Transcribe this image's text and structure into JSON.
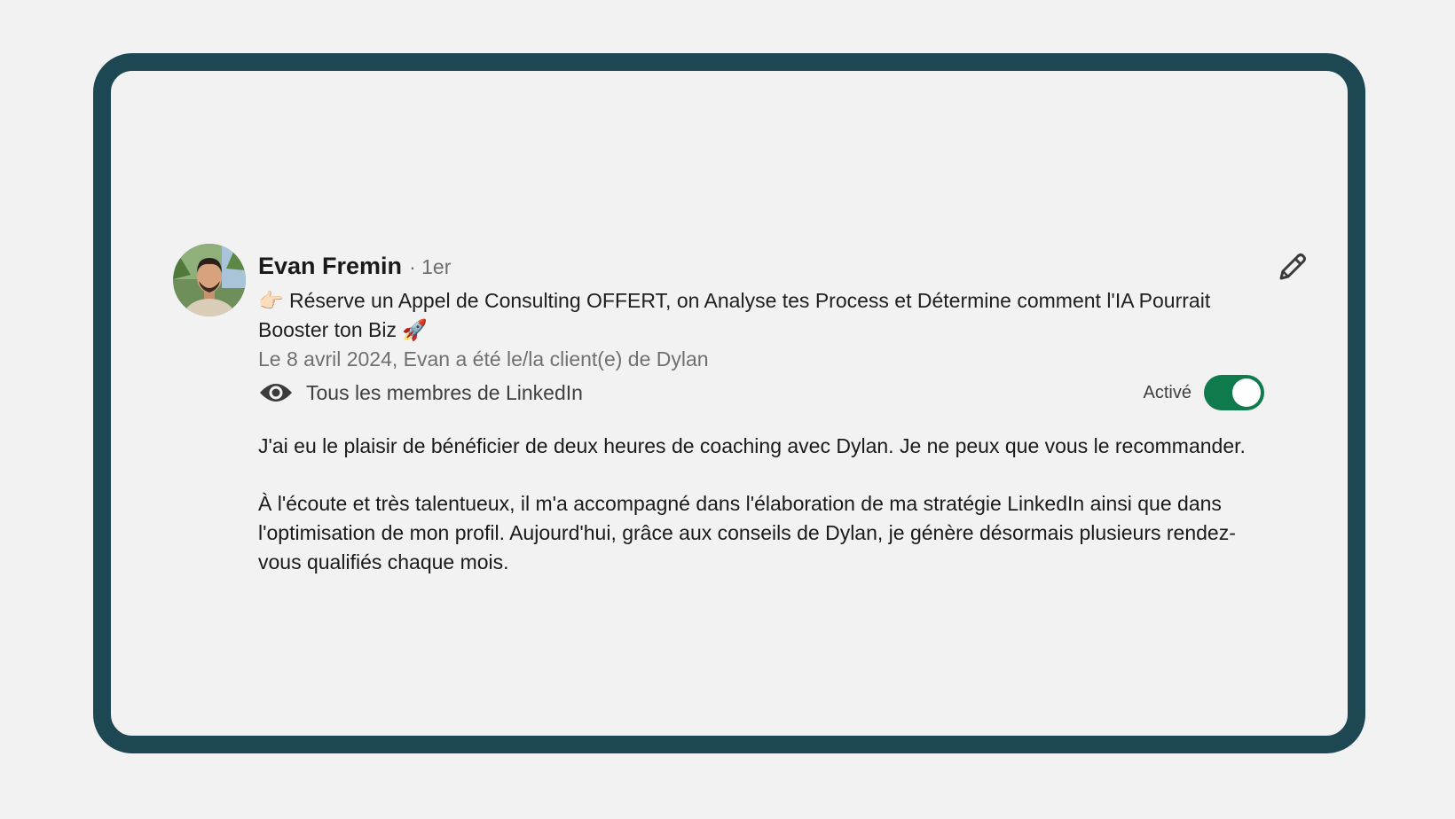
{
  "recommendation": {
    "author_name": "Evan Fremin",
    "connection_degree": "· 1er",
    "headline": "👉🏻 Réserve un Appel de Consulting OFFERT, on Analyse tes Process et Détermine comment l'IA Pourrait Booster ton Biz 🚀",
    "date_relation": "Le 8 avril 2024, Evan a été le/la client(e) de Dylan",
    "visibility": "Tous les membres de LinkedIn",
    "toggle_label": "Activé",
    "toggle_on": true,
    "paragraphs": [
      "J'ai eu le plaisir de bénéficier de deux heures de coaching avec Dylan. Je ne peux que vous le recommander.",
      "À l'écoute et très talentueux, il m'a accompagné dans l'élaboration de ma stratégie LinkedIn ainsi que dans l'optimisation de mon profil. Aujourd'hui, grâce aux conseils de Dylan, je génère désormais plusieurs rendez-vous qualifiés chaque mois."
    ]
  },
  "icons": {
    "visibility": "eye-icon",
    "edit": "pencil-icon"
  },
  "colors": {
    "frame": "#1d4752",
    "toggle_active": "#0f7a4b",
    "background": "#f2f2f2"
  }
}
